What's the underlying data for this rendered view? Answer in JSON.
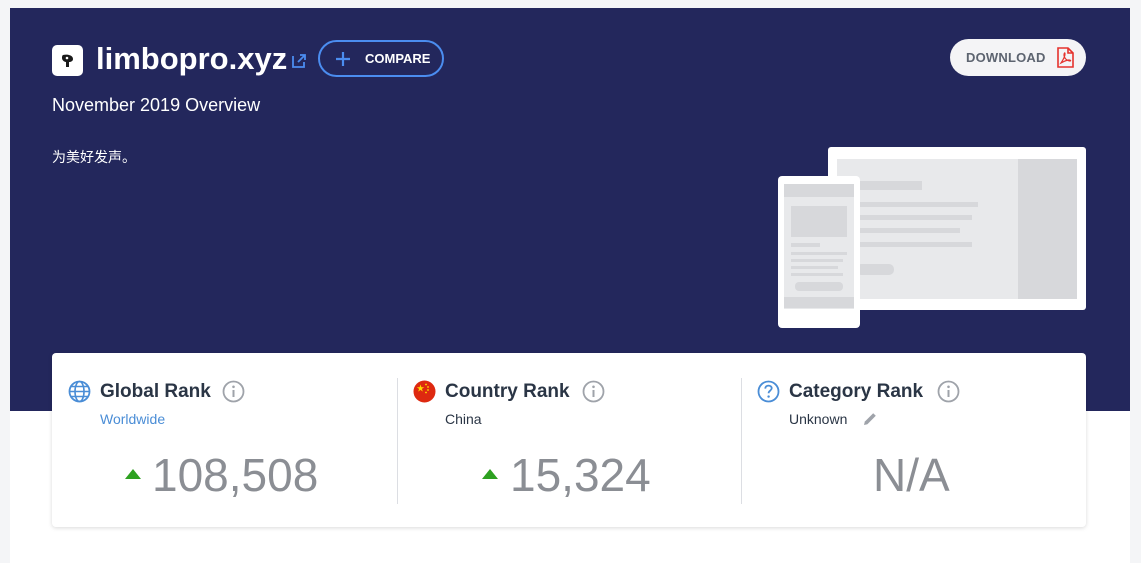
{
  "header": {
    "site_name": "limbopro.xyz",
    "compare_label": "COMPARE",
    "download_label": "DOWNLOAD",
    "overview_title": "November 2019 Overview",
    "tagline": "为美好发声。"
  },
  "ranks": {
    "global": {
      "title": "Global Rank",
      "subtitle": "Worldwide",
      "value": "108,508",
      "trend": "up"
    },
    "country": {
      "title": "Country Rank",
      "subtitle": "China",
      "value": "15,324",
      "trend": "up"
    },
    "category": {
      "title": "Category Rank",
      "subtitle": "Unknown",
      "value": "N/A"
    }
  },
  "colors": {
    "hero_bg": "#23275c",
    "accent_blue": "#4b8df0",
    "trend_up": "#2ea121",
    "value_gray": "#8b8e94",
    "pdf_red": "#e5322d"
  },
  "icons": {
    "site_logo": "site-logo-icon",
    "external": "external-link-icon",
    "compare": "plus-icon",
    "download": "pdf-icon",
    "global": "globe-icon",
    "country": "china-flag-icon",
    "category": "question-circle-icon",
    "info": "info-icon",
    "edit": "pencil-icon",
    "trend_up": "triangle-up-icon"
  }
}
